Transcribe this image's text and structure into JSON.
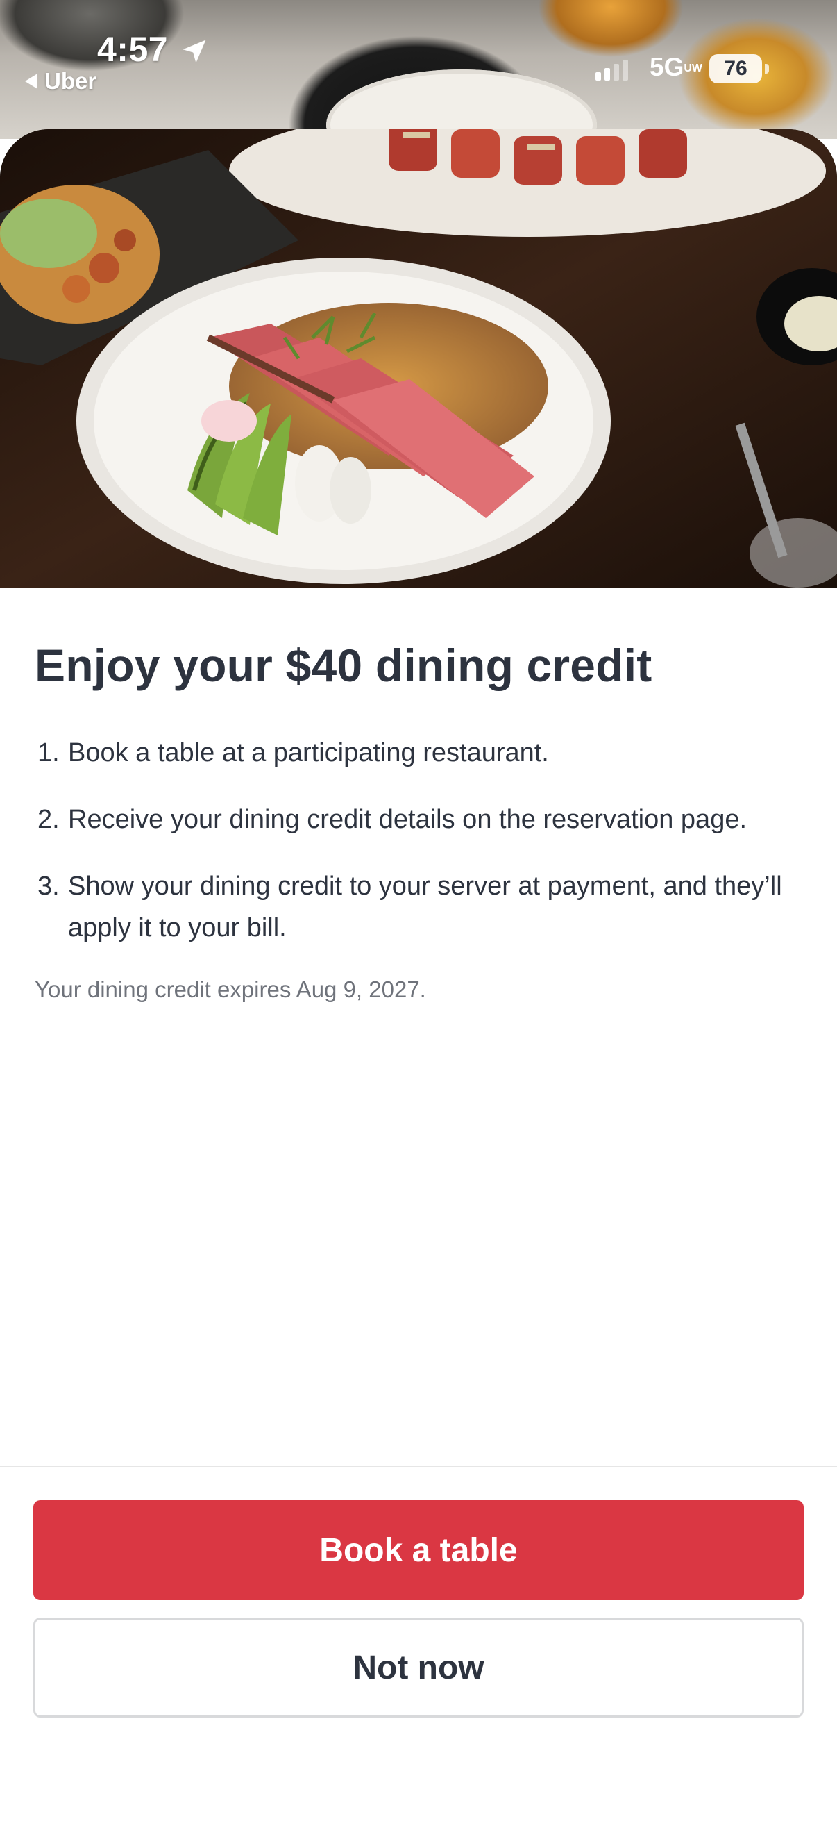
{
  "status_bar": {
    "time": "4:57",
    "back_app_label": "Uber",
    "network": "5G",
    "network_sub": "UW",
    "battery": "76",
    "icons": [
      "location-arrow-icon",
      "back-triangle-icon",
      "cellular-signal-icon",
      "battery-icon"
    ]
  },
  "hero": {
    "image_description_icon": "food-photo"
  },
  "content": {
    "title": "Enjoy your $40 dining credit",
    "steps": [
      {
        "num": "1.",
        "text": "Book a table at a participating restaurant."
      },
      {
        "num": "2.",
        "text": "Receive your dining credit details on the reservation page."
      },
      {
        "num": "3.",
        "text": "Show your dining credit to your server at payment, and they’ll apply it to your bill."
      }
    ],
    "expiry": "Your dining credit expires Aug 9, 2027."
  },
  "actions": {
    "primary_label": "Book a table",
    "secondary_label": "Not now"
  },
  "colors": {
    "primary": "#da3743",
    "text": "#2d333f",
    "muted": "#6f737b",
    "border": "#d8d9db"
  }
}
